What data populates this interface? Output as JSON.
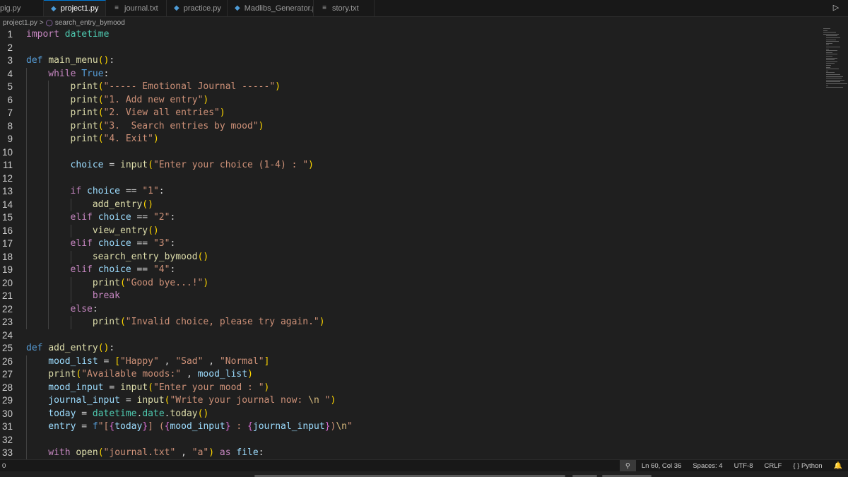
{
  "tabs": [
    {
      "name": "pig.py",
      "kind": "py",
      "active": false
    },
    {
      "name": "project1.py",
      "kind": "py",
      "active": true
    },
    {
      "name": "journal.txt",
      "kind": "txt",
      "active": false
    },
    {
      "name": "practice.py",
      "kind": "py",
      "active": false
    },
    {
      "name": "Madlibs_Generator.py",
      "kind": "py",
      "active": false
    },
    {
      "name": "story.txt",
      "kind": "txt",
      "active": false
    }
  ],
  "icons": {
    "py_file": "python-file-icon",
    "txt_file": "text-file-icon",
    "close": "close-icon",
    "run": "run-icon",
    "symbol": "symbol-method-icon",
    "zoom": "zoom-icon",
    "bell": "bell-icon"
  },
  "breadcrumb": {
    "file": "project1.py",
    "separator": ">",
    "symbol": "search_entry_bymood"
  },
  "code_lines": [
    {
      "n": "1",
      "indent": 0,
      "tokens": [
        [
          "kw-import",
          "import"
        ],
        [
          "op",
          " "
        ],
        [
          "mod",
          "datetime"
        ]
      ]
    },
    {
      "n": "2",
      "indent": 0,
      "tokens": []
    },
    {
      "n": "3",
      "indent": 0,
      "tokens": [
        [
          "kw-def",
          "def"
        ],
        [
          "op",
          " "
        ],
        [
          "fn",
          "main_menu"
        ],
        [
          "pn",
          "()"
        ],
        [
          "op",
          ":"
        ]
      ]
    },
    {
      "n": "4",
      "indent": 1,
      "tokens": [
        [
          "kw",
          "while"
        ],
        [
          "op",
          " "
        ],
        [
          "bool",
          "True"
        ],
        [
          "op",
          ":"
        ]
      ]
    },
    {
      "n": "5",
      "indent": 2,
      "tokens": [
        [
          "fn",
          "print"
        ],
        [
          "pn",
          "("
        ],
        [
          "str",
          "\"----- Emotional Journal -----\""
        ],
        [
          "pn",
          ")"
        ]
      ]
    },
    {
      "n": "6",
      "indent": 2,
      "tokens": [
        [
          "fn",
          "print"
        ],
        [
          "pn",
          "("
        ],
        [
          "str",
          "\"1. Add new entry\""
        ],
        [
          "pn",
          ")"
        ]
      ]
    },
    {
      "n": "7",
      "indent": 2,
      "tokens": [
        [
          "fn",
          "print"
        ],
        [
          "pn",
          "("
        ],
        [
          "str",
          "\"2. View all entries\""
        ],
        [
          "pn",
          ")"
        ]
      ]
    },
    {
      "n": "8",
      "indent": 2,
      "tokens": [
        [
          "fn",
          "print"
        ],
        [
          "pn",
          "("
        ],
        [
          "str",
          "\"3.  Search entries by mood\""
        ],
        [
          "pn",
          ")"
        ]
      ]
    },
    {
      "n": "9",
      "indent": 2,
      "tokens": [
        [
          "fn",
          "print"
        ],
        [
          "pn",
          "("
        ],
        [
          "str",
          "\"4. Exit\""
        ],
        [
          "pn",
          ")"
        ]
      ]
    },
    {
      "n": "10",
      "indent": 2,
      "tokens": []
    },
    {
      "n": "11",
      "indent": 2,
      "tokens": [
        [
          "var",
          "choice"
        ],
        [
          "op",
          " = "
        ],
        [
          "fn",
          "input"
        ],
        [
          "pn",
          "("
        ],
        [
          "str",
          "\"Enter your choice (1-4) : \""
        ],
        [
          "pn",
          ")"
        ]
      ]
    },
    {
      "n": "12",
      "indent": 2,
      "tokens": []
    },
    {
      "n": "13",
      "indent": 2,
      "tokens": [
        [
          "kw",
          "if"
        ],
        [
          "op",
          " "
        ],
        [
          "var",
          "choice"
        ],
        [
          "op",
          " == "
        ],
        [
          "str",
          "\"1\""
        ],
        [
          "op",
          ":"
        ]
      ]
    },
    {
      "n": "14",
      "indent": 3,
      "tokens": [
        [
          "fn",
          "add_entry"
        ],
        [
          "pn",
          "()"
        ]
      ]
    },
    {
      "n": "15",
      "indent": 2,
      "tokens": [
        [
          "kw",
          "elif"
        ],
        [
          "op",
          " "
        ],
        [
          "var",
          "choice"
        ],
        [
          "op",
          " == "
        ],
        [
          "str",
          "\"2\""
        ],
        [
          "op",
          ":"
        ]
      ]
    },
    {
      "n": "16",
      "indent": 3,
      "tokens": [
        [
          "fn",
          "view_entry"
        ],
        [
          "pn",
          "()"
        ]
      ]
    },
    {
      "n": "17",
      "indent": 2,
      "tokens": [
        [
          "kw",
          "elif"
        ],
        [
          "op",
          " "
        ],
        [
          "var",
          "choice"
        ],
        [
          "op",
          " == "
        ],
        [
          "str",
          "\"3\""
        ],
        [
          "op",
          ":"
        ]
      ]
    },
    {
      "n": "18",
      "indent": 3,
      "tokens": [
        [
          "fn",
          "search_entry_bymood"
        ],
        [
          "pn",
          "()"
        ]
      ]
    },
    {
      "n": "19",
      "indent": 2,
      "tokens": [
        [
          "kw",
          "elif"
        ],
        [
          "op",
          " "
        ],
        [
          "var",
          "choice"
        ],
        [
          "op",
          " == "
        ],
        [
          "str",
          "\"4\""
        ],
        [
          "op",
          ":"
        ]
      ]
    },
    {
      "n": "20",
      "indent": 3,
      "tokens": [
        [
          "fn",
          "print"
        ],
        [
          "pn",
          "("
        ],
        [
          "str",
          "\"Good bye...!\""
        ],
        [
          "pn",
          ")"
        ]
      ]
    },
    {
      "n": "21",
      "indent": 3,
      "tokens": [
        [
          "kw",
          "break"
        ]
      ]
    },
    {
      "n": "22",
      "indent": 2,
      "tokens": [
        [
          "kw",
          "else"
        ],
        [
          "op",
          ":"
        ]
      ]
    },
    {
      "n": "23",
      "indent": 3,
      "tokens": [
        [
          "fn",
          "print"
        ],
        [
          "pn",
          "("
        ],
        [
          "str",
          "\"Invalid choice, please try again.\""
        ],
        [
          "pn",
          ")"
        ]
      ]
    },
    {
      "n": "24",
      "indent": 0,
      "tokens": []
    },
    {
      "n": "25",
      "indent": 0,
      "tokens": [
        [
          "kw-def",
          "def"
        ],
        [
          "op",
          " "
        ],
        [
          "fn",
          "add_entry"
        ],
        [
          "pn",
          "()"
        ],
        [
          "op",
          ":"
        ]
      ]
    },
    {
      "n": "26",
      "indent": 1,
      "tokens": [
        [
          "var",
          "mood_list"
        ],
        [
          "op",
          " = "
        ],
        [
          "pn",
          "["
        ],
        [
          "str",
          "\"Happy\""
        ],
        [
          "op",
          " , "
        ],
        [
          "str",
          "\"Sad\""
        ],
        [
          "op",
          " , "
        ],
        [
          "str",
          "\"Normal\""
        ],
        [
          "pn",
          "]"
        ]
      ]
    },
    {
      "n": "27",
      "indent": 1,
      "tokens": [
        [
          "fn",
          "print"
        ],
        [
          "pn",
          "("
        ],
        [
          "str",
          "\"Available moods:\""
        ],
        [
          "op",
          " , "
        ],
        [
          "var",
          "mood_list"
        ],
        [
          "pn",
          ")"
        ]
      ]
    },
    {
      "n": "28",
      "indent": 1,
      "tokens": [
        [
          "var",
          "mood_input"
        ],
        [
          "op",
          " = "
        ],
        [
          "fn",
          "input"
        ],
        [
          "pn",
          "("
        ],
        [
          "str",
          "\"Enter your mood : \""
        ],
        [
          "pn",
          ")"
        ]
      ]
    },
    {
      "n": "29",
      "indent": 1,
      "tokens": [
        [
          "var",
          "journal_input"
        ],
        [
          "op",
          " = "
        ],
        [
          "fn",
          "input"
        ],
        [
          "pn",
          "("
        ],
        [
          "str",
          "\"Write your journal now: "
        ],
        [
          "esc",
          "\\n"
        ],
        [
          "str",
          " \""
        ],
        [
          "pn",
          ")"
        ]
      ]
    },
    {
      "n": "30",
      "indent": 1,
      "tokens": [
        [
          "var",
          "today"
        ],
        [
          "op",
          " = "
        ],
        [
          "mod",
          "datetime"
        ],
        [
          "op",
          "."
        ],
        [
          "mod",
          "date"
        ],
        [
          "op",
          "."
        ],
        [
          "fn",
          "today"
        ],
        [
          "pn",
          "()"
        ]
      ]
    },
    {
      "n": "31",
      "indent": 1,
      "tokens": [
        [
          "var",
          "entry"
        ],
        [
          "op",
          " = "
        ],
        [
          "kw-def",
          "f"
        ],
        [
          "str",
          "\"["
        ],
        [
          "pn2",
          "{"
        ],
        [
          "var",
          "today"
        ],
        [
          "pn2",
          "}"
        ],
        [
          "str",
          "] ("
        ],
        [
          "pn2",
          "{"
        ],
        [
          "var",
          "mood_input"
        ],
        [
          "pn2",
          "}"
        ],
        [
          "str",
          " : "
        ],
        [
          "pn2",
          "{"
        ],
        [
          "var",
          "journal_input"
        ],
        [
          "pn2",
          "}"
        ],
        [
          "str",
          ")"
        ],
        [
          "esc",
          "\\n"
        ],
        [
          "str",
          "\""
        ]
      ]
    },
    {
      "n": "32",
      "indent": 1,
      "tokens": []
    },
    {
      "n": "33",
      "indent": 1,
      "tokens": [
        [
          "kw",
          "with"
        ],
        [
          "op",
          " "
        ],
        [
          "fn",
          "open"
        ],
        [
          "pn",
          "("
        ],
        [
          "str",
          "\"journal.txt\""
        ],
        [
          "op",
          " , "
        ],
        [
          "str",
          "\"a\""
        ],
        [
          "pn",
          ")"
        ],
        [
          "op",
          " "
        ],
        [
          "kw",
          "as"
        ],
        [
          "op",
          " "
        ],
        [
          "var",
          "file"
        ],
        [
          "op",
          ":"
        ]
      ]
    }
  ],
  "status": {
    "left": "0",
    "position": "Ln 60, Col 36",
    "spaces": "Spaces: 4",
    "encoding": "UTF-8",
    "eol": "CRLF",
    "language": "Python",
    "language_icon": "{ }"
  }
}
